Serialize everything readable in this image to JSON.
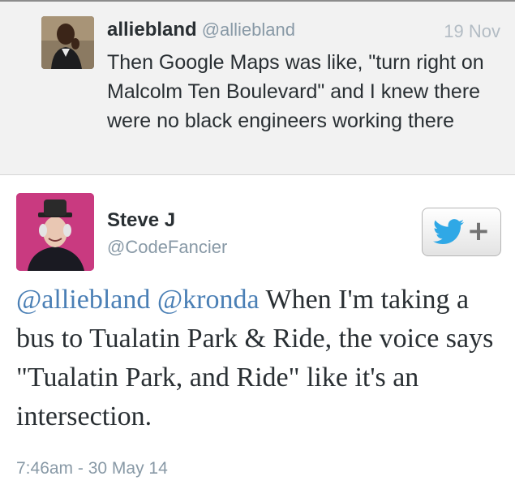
{
  "parent_tweet": {
    "name": "alliebland",
    "handle": "@alliebland",
    "date": "19 Nov",
    "text": "Then Google Maps was like, \"turn right on Malcolm Ten Boulevard\" and I knew there were no black engineers working there"
  },
  "main_tweet": {
    "name": "Steve J",
    "handle": "@CodeFancier",
    "mentions": [
      "@alliebland",
      "@kronda"
    ],
    "text": "When I'm taking a bus to Tualatin Park & Ride, the voice says \"Tualatin Park, and Ride\" like it's an intersection.",
    "timestamp": "7:46am - 30 May 14",
    "follow_button": {
      "icon": "twitter-bird-icon",
      "plus": "+"
    }
  },
  "colors": {
    "mention": "#4a7fb5",
    "twitter_blue": "#2fa8e6",
    "parent_background": "#f2f2f2",
    "secondary_text": "#8899a6"
  }
}
